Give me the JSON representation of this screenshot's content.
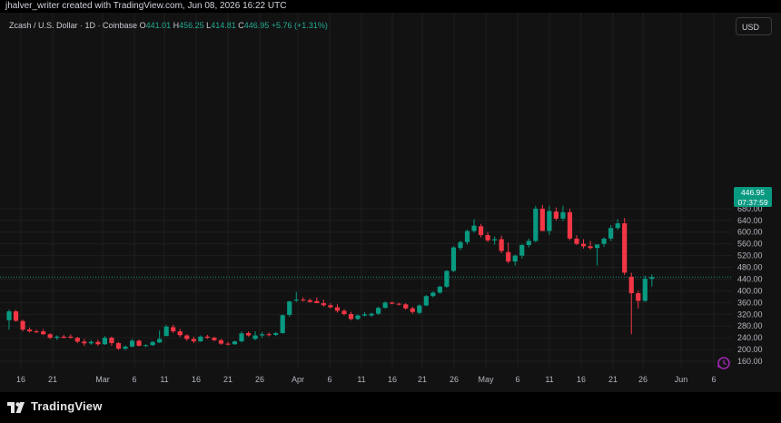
{
  "header": {
    "credit": "jhalver_writer created with TradingView.com, Jun 08, 2026 16:22 UTC"
  },
  "legend": {
    "symbol": "Zcash / U.S. Dollar · 1D · Coinbase",
    "o_label": "O",
    "o": "441.01",
    "h_label": "H",
    "h": "456.25",
    "l_label": "L",
    "l": "414.81",
    "c_label": "C",
    "c": "446.95",
    "change": "+5.76 (+1.31%)"
  },
  "currency_button": "USD",
  "last_price": {
    "price": "446.95",
    "countdown": "07:37:59"
  },
  "brand": "TradingView",
  "colors": {
    "up": "#089981",
    "down": "#f23645",
    "background": "#121212",
    "grid": "#1e1e1e"
  },
  "chart_data": {
    "type": "candlestick",
    "title": "Zcash / U.S. Dollar · 1D · Coinbase",
    "ylim": [
      150,
      700
    ],
    "y_ticks": [
      160,
      200,
      240,
      280,
      320,
      360,
      400,
      440,
      480,
      520,
      560,
      600,
      640,
      680
    ],
    "x_ticks": [
      "16",
      "21",
      "Mar",
      "6",
      "11",
      "16",
      "21",
      "26",
      "Apr",
      "6",
      "11",
      "16",
      "21",
      "26",
      "May",
      "6",
      "11",
      "16",
      "21",
      "26",
      "Jun",
      "6"
    ],
    "grid": true,
    "last_value": 446.95,
    "candles": [
      {
        "o": 300,
        "h": 335,
        "l": 268,
        "c": 330
      },
      {
        "o": 330,
        "h": 335,
        "l": 295,
        "c": 298
      },
      {
        "o": 297,
        "h": 302,
        "l": 262,
        "c": 268
      },
      {
        "o": 268,
        "h": 275,
        "l": 258,
        "c": 262
      },
      {
        "o": 262,
        "h": 268,
        "l": 256,
        "c": 260
      },
      {
        "o": 262,
        "h": 270,
        "l": 250,
        "c": 252
      },
      {
        "o": 252,
        "h": 256,
        "l": 236,
        "c": 240
      },
      {
        "o": 240,
        "h": 248,
        "l": 233,
        "c": 244
      },
      {
        "o": 244,
        "h": 250,
        "l": 238,
        "c": 240
      },
      {
        "o": 244,
        "h": 252,
        "l": 238,
        "c": 240
      },
      {
        "o": 240,
        "h": 244,
        "l": 222,
        "c": 227
      },
      {
        "o": 227,
        "h": 236,
        "l": 212,
        "c": 221
      },
      {
        "o": 221,
        "h": 232,
        "l": 216,
        "c": 226
      },
      {
        "o": 226,
        "h": 234,
        "l": 212,
        "c": 218
      },
      {
        "o": 218,
        "h": 246,
        "l": 216,
        "c": 240
      },
      {
        "o": 240,
        "h": 244,
        "l": 212,
        "c": 222
      },
      {
        "o": 222,
        "h": 226,
        "l": 198,
        "c": 203
      },
      {
        "o": 203,
        "h": 214,
        "l": 198,
        "c": 210
      },
      {
        "o": 210,
        "h": 236,
        "l": 208,
        "c": 230
      },
      {
        "o": 230,
        "h": 234,
        "l": 210,
        "c": 213
      },
      {
        "o": 214,
        "h": 218,
        "l": 208,
        "c": 215
      },
      {
        "o": 215,
        "h": 228,
        "l": 212,
        "c": 226
      },
      {
        "o": 224,
        "h": 265,
        "l": 222,
        "c": 236
      },
      {
        "o": 246,
        "h": 284,
        "l": 246,
        "c": 278
      },
      {
        "o": 276,
        "h": 284,
        "l": 256,
        "c": 262
      },
      {
        "o": 262,
        "h": 270,
        "l": 243,
        "c": 249
      },
      {
        "o": 248,
        "h": 252,
        "l": 230,
        "c": 236
      },
      {
        "o": 236,
        "h": 244,
        "l": 222,
        "c": 228
      },
      {
        "o": 228,
        "h": 248,
        "l": 226,
        "c": 244
      },
      {
        "o": 244,
        "h": 250,
        "l": 236,
        "c": 240
      },
      {
        "o": 240,
        "h": 244,
        "l": 228,
        "c": 232
      },
      {
        "o": 232,
        "h": 236,
        "l": 216,
        "c": 220
      },
      {
        "o": 220,
        "h": 226,
        "l": 214,
        "c": 218
      },
      {
        "o": 218,
        "h": 230,
        "l": 216,
        "c": 228
      },
      {
        "o": 228,
        "h": 262,
        "l": 224,
        "c": 255
      },
      {
        "o": 256,
        "h": 262,
        "l": 244,
        "c": 248
      },
      {
        "o": 236,
        "h": 262,
        "l": 232,
        "c": 248
      },
      {
        "o": 248,
        "h": 260,
        "l": 240,
        "c": 252
      },
      {
        "o": 252,
        "h": 258,
        "l": 245,
        "c": 250
      },
      {
        "o": 250,
        "h": 260,
        "l": 246,
        "c": 256
      },
      {
        "o": 256,
        "h": 320,
        "l": 254,
        "c": 317
      },
      {
        "o": 318,
        "h": 366,
        "l": 312,
        "c": 364
      },
      {
        "o": 367,
        "h": 396,
        "l": 362,
        "c": 370
      },
      {
        "o": 370,
        "h": 378,
        "l": 364,
        "c": 368
      },
      {
        "o": 368,
        "h": 374,
        "l": 360,
        "c": 362
      },
      {
        "o": 365,
        "h": 378,
        "l": 360,
        "c": 358
      },
      {
        "o": 358,
        "h": 370,
        "l": 346,
        "c": 351
      },
      {
        "o": 351,
        "h": 358,
        "l": 340,
        "c": 344
      },
      {
        "o": 344,
        "h": 354,
        "l": 326,
        "c": 332
      },
      {
        "o": 332,
        "h": 338,
        "l": 316,
        "c": 321
      },
      {
        "o": 321,
        "h": 328,
        "l": 300,
        "c": 304
      },
      {
        "o": 304,
        "h": 320,
        "l": 300,
        "c": 316
      },
      {
        "o": 316,
        "h": 328,
        "l": 312,
        "c": 320
      },
      {
        "o": 316,
        "h": 326,
        "l": 312,
        "c": 322
      },
      {
        "o": 322,
        "h": 346,
        "l": 318,
        "c": 342
      },
      {
        "o": 342,
        "h": 364,
        "l": 340,
        "c": 360
      },
      {
        "o": 360,
        "h": 364,
        "l": 354,
        "c": 356
      },
      {
        "o": 356,
        "h": 360,
        "l": 350,
        "c": 354
      },
      {
        "o": 354,
        "h": 358,
        "l": 336,
        "c": 340
      },
      {
        "o": 340,
        "h": 346,
        "l": 322,
        "c": 328
      },
      {
        "o": 325,
        "h": 354,
        "l": 320,
        "c": 350
      },
      {
        "o": 350,
        "h": 386,
        "l": 348,
        "c": 382
      },
      {
        "o": 382,
        "h": 398,
        "l": 378,
        "c": 394
      },
      {
        "o": 394,
        "h": 418,
        "l": 390,
        "c": 414
      },
      {
        "o": 414,
        "h": 470,
        "l": 410,
        "c": 468
      },
      {
        "o": 468,
        "h": 552,
        "l": 464,
        "c": 548
      },
      {
        "o": 546,
        "h": 570,
        "l": 538,
        "c": 566
      },
      {
        "o": 566,
        "h": 608,
        "l": 558,
        "c": 604
      },
      {
        "o": 604,
        "h": 644,
        "l": 598,
        "c": 622
      },
      {
        "o": 620,
        "h": 628,
        "l": 582,
        "c": 590
      },
      {
        "o": 590,
        "h": 600,
        "l": 566,
        "c": 572
      },
      {
        "o": 572,
        "h": 586,
        "l": 558,
        "c": 576
      },
      {
        "o": 576,
        "h": 588,
        "l": 528,
        "c": 536
      },
      {
        "o": 532,
        "h": 564,
        "l": 494,
        "c": 500
      },
      {
        "o": 500,
        "h": 524,
        "l": 486,
        "c": 520
      },
      {
        "o": 520,
        "h": 560,
        "l": 510,
        "c": 556
      },
      {
        "o": 556,
        "h": 578,
        "l": 548,
        "c": 570
      },
      {
        "o": 570,
        "h": 690,
        "l": 566,
        "c": 680
      },
      {
        "o": 680,
        "h": 692,
        "l": 636,
        "c": 604
      },
      {
        "o": 604,
        "h": 690,
        "l": 590,
        "c": 672
      },
      {
        "o": 670,
        "h": 684,
        "l": 640,
        "c": 646
      },
      {
        "o": 646,
        "h": 690,
        "l": 638,
        "c": 668
      },
      {
        "o": 668,
        "h": 680,
        "l": 572,
        "c": 578
      },
      {
        "o": 578,
        "h": 590,
        "l": 556,
        "c": 560
      },
      {
        "o": 560,
        "h": 576,
        "l": 544,
        "c": 552
      },
      {
        "o": 552,
        "h": 570,
        "l": 540,
        "c": 546
      },
      {
        "o": 546,
        "h": 552,
        "l": 486,
        "c": 558
      },
      {
        "o": 560,
        "h": 582,
        "l": 550,
        "c": 578
      },
      {
        "o": 578,
        "h": 624,
        "l": 570,
        "c": 614
      },
      {
        "o": 614,
        "h": 644,
        "l": 608,
        "c": 630
      },
      {
        "o": 630,
        "h": 648,
        "l": 454,
        "c": 462
      },
      {
        "o": 448,
        "h": 462,
        "l": 252,
        "c": 392
      },
      {
        "o": 392,
        "h": 400,
        "l": 340,
        "c": 366
      },
      {
        "o": 366,
        "h": 452,
        "l": 362,
        "c": 441
      },
      {
        "o": 441.01,
        "h": 456.25,
        "l": 414.81,
        "c": 446.95
      }
    ]
  }
}
